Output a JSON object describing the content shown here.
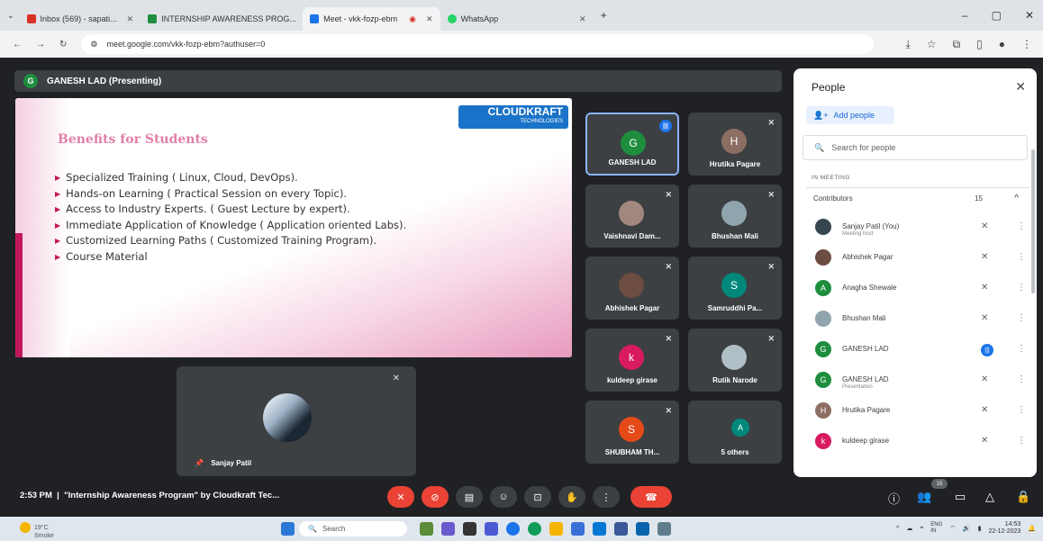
{
  "browser": {
    "tabs": [
      {
        "label": "Inbox (569) - sapati...",
        "color": "#d93025",
        "active": false
      },
      {
        "label": "INTERNSHIP AWARENESS PROG...",
        "color": "#1e8e3e",
        "active": false
      },
      {
        "label": "Meet - vkk-fozp-ebm",
        "color": "#1a73e8",
        "active": true
      },
      {
        "label": "WhatsApp",
        "color": "#25d366",
        "active": false
      }
    ],
    "url": "meet.google.com/vkk-fozp-ebm?authuser=0"
  },
  "meet": {
    "presenter_initial": "G",
    "presenter_bar": "GANESH LAD (Presenting)",
    "slide": {
      "logo": "CLOUDKRAFT",
      "logo_sub": "TECHNOLOGIES",
      "title": "Benefits for Students",
      "bullets": [
        "Specialized Training ( Linux, Cloud, DevOps).",
        "Hands-on Learning  ( Practical Session on every Topic).",
        "Access to Industry Experts. ( Guest Lecture by expert).",
        "Immediate Application of Knowledge ( Application oriented Labs).",
        "Customized Learning Paths ( Customized Training Program).",
        "Course Material"
      ]
    },
    "tiles": [
      {
        "name": "GANESH LAD",
        "initial": "G",
        "color": "#1e8e3e"
      },
      {
        "name": "Hrutika Pagare",
        "initial": "H",
        "color": "#8d6e63"
      },
      {
        "name": "Vaishnavi Dam...",
        "initial": "",
        "color": "#a1887f"
      },
      {
        "name": "Bhushan Mali",
        "initial": "",
        "color": "#90a4ae"
      },
      {
        "name": "Abhishek Pagar",
        "initial": "",
        "color": "#6d4c41"
      },
      {
        "name": "Samruddhi Pa...",
        "initial": "S",
        "color": "#00897b"
      },
      {
        "name": "kuldeep girase",
        "initial": "k",
        "color": "#d81b60"
      },
      {
        "name": "Rutik Narode",
        "initial": "",
        "color": "#b0bec5"
      },
      {
        "name": "SHUBHAM TH...",
        "initial": "S",
        "color": "#e64a19"
      },
      {
        "name": "5 others",
        "initial": "A",
        "color": "#00897b"
      }
    ],
    "self_name": "Sanjay Patil",
    "time": "2:53 PM",
    "meeting_title": "\"Internship Awareness Program\" by Cloudkraft Tec...",
    "participant_count": "15"
  },
  "people": {
    "title": "People",
    "add_people": "Add people",
    "search_placeholder": "Search for people",
    "in_meeting": "IN MEETING",
    "contributors_label": "Contributors",
    "contributors_count": "15",
    "list": [
      {
        "name": "Sanjay Patil (You)",
        "sub": "Meeting host",
        "initial": "",
        "color": "#37474f",
        "speaking": false
      },
      {
        "name": "Abhishek Pagar",
        "sub": "",
        "initial": "",
        "color": "#6d4c41",
        "speaking": false
      },
      {
        "name": "Anagha Shewale",
        "sub": "",
        "initial": "A",
        "color": "#1e8e3e",
        "speaking": false
      },
      {
        "name": "Bhushan Mali",
        "sub": "",
        "initial": "",
        "color": "#90a4ae",
        "speaking": false
      },
      {
        "name": "GANESH LAD",
        "sub": "",
        "initial": "G",
        "color": "#1e8e3e",
        "speaking": true
      },
      {
        "name": "GANESH LAD",
        "sub": "Presentation",
        "initial": "G",
        "color": "#1e8e3e",
        "speaking": false
      },
      {
        "name": "Hrutika Pagare",
        "sub": "",
        "initial": "H",
        "color": "#8d6e63",
        "speaking": false
      },
      {
        "name": "kuldeep girase",
        "sub": "",
        "initial": "k",
        "color": "#d81b60",
        "speaking": false
      }
    ]
  },
  "taskbar": {
    "temp": "19°C",
    "weather": "Smoke",
    "search": "Search",
    "lang": "ENG",
    "lang2": "IN",
    "clock_time": "14:53",
    "clock_date": "22-12-2023"
  }
}
